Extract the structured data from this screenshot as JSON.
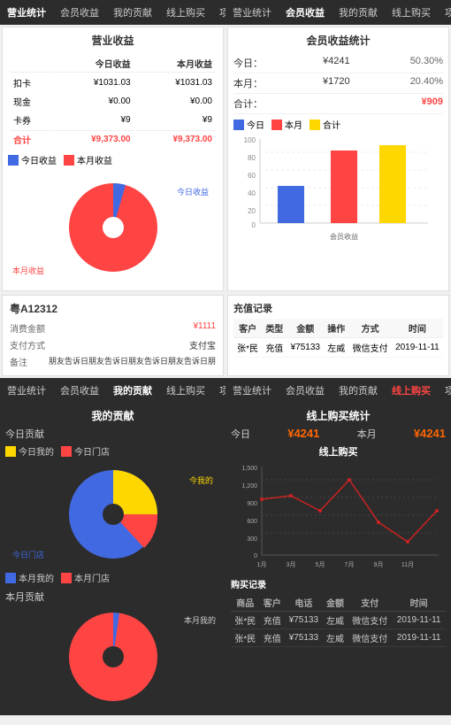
{
  "nav1": {
    "items": [
      "营业统计",
      "会员收益",
      "我的贡献",
      "线上购买",
      "项目"
    ],
    "active": "营业统计"
  },
  "nav2": {
    "items": [
      "营业统计",
      "会员收益",
      "我的贡献",
      "线上购买",
      "项目"
    ],
    "active": "会员收益"
  },
  "nav3": {
    "items": [
      "营业统计",
      "会员收益",
      "我的贡献",
      "线上购买",
      "项目"
    ],
    "active": "我的贡献"
  },
  "nav4": {
    "items": [
      "营业统计",
      "会员收益",
      "我的贡献",
      "线上购买",
      "项目"
    ],
    "active": "线上购买"
  },
  "revenue": {
    "title": "营业收益",
    "today_label": "今日收益",
    "month_label": "本月收益",
    "rows": [
      {
        "name": "扣卡",
        "today": "¥1031.03",
        "month": "¥1031.03"
      },
      {
        "name": "现金",
        "today": "¥0.00",
        "month": "¥0.00"
      },
      {
        "name": "卡券",
        "today": "¥9",
        "month": "¥9"
      }
    ],
    "total_label": "合计",
    "total_today": "¥9,373.00",
    "total_month": "¥9,373.00"
  },
  "member_stats": {
    "title": "会员收益统计",
    "today_label": "今日：",
    "today_value": "¥4241",
    "today_pct": "50.30%",
    "month_label": "本月：",
    "month_value": "¥1720",
    "month_pct": "20.40%",
    "total_label": "合计：",
    "total_value": "¥909"
  },
  "legend_revenue": {
    "today": "今日收益",
    "month": "本月收益",
    "colors": [
      "#4169E1",
      "#ff4444"
    ]
  },
  "legend_member": {
    "items": [
      "今日",
      "本月",
      "合计"
    ],
    "colors": [
      "#4169E1",
      "#ff4444",
      "#FFD700"
    ]
  },
  "member_bar": {
    "y_max": 100,
    "y_labels": [
      "100",
      "80",
      "60",
      "40",
      "20",
      "0"
    ],
    "bars": [
      {
        "label": "今日",
        "value": 42,
        "color": "#4169E1"
      },
      {
        "label": "本月",
        "value": 82,
        "color": "#ff4444"
      },
      {
        "label": "合计",
        "value": 88,
        "color": "#FFD700"
      }
    ],
    "x_label": "会员收益"
  },
  "card_info": {
    "id": "粤A12312",
    "rows": [
      {
        "label": "消费金额",
        "value": "¥1111",
        "red": true
      },
      {
        "label": "支付方式",
        "value": "支付宝"
      },
      {
        "label": "备注",
        "value": "朋友告诉日朋友告诉日朋友告诉日朋友告诉日朋"
      }
    ]
  },
  "recharge": {
    "title": "充值记录",
    "headers": [
      "客户",
      "类型",
      "金额",
      "操作",
      "方式",
      "时间"
    ],
    "rows": [
      {
        "customer": "张*民",
        "type": "充值",
        "amount": "¥75133",
        "op": "左威",
        "method": "微信支付",
        "time": "2019-11-11"
      }
    ]
  },
  "contribution": {
    "title": "我的贡献",
    "today_label": "今日贡献",
    "legend_my": "今日我的",
    "legend_shop": "今日门店",
    "colors_today": [
      "#FFD700",
      "#4169E1",
      "#ff4444"
    ],
    "month_label": "本月贡献",
    "legend_month_my": "本月我的",
    "legend_month_shop": "本月门店",
    "pie_today_label": "今我的",
    "pie_month_label": "本月我的"
  },
  "online": {
    "title": "线上购买统计",
    "today_label": "今日",
    "today_value": "¥4241",
    "month_label": "本月",
    "month_value": "¥4241",
    "chart_title": "线上购买",
    "x_labels": [
      "1月",
      "3月",
      "5月",
      "7月",
      "9月",
      "11月"
    ],
    "y_max": 1500,
    "y_labels": [
      "1,500",
      "1,200",
      "900",
      "600",
      "300",
      "0"
    ],
    "purchase_title": "购买记录",
    "purchase_headers": [
      "商品",
      "客户",
      "电话",
      "金额",
      "支付",
      "时间"
    ],
    "purchase_rows": [
      {
        "product": "张*民",
        "customer": "充值",
        "phone": "¥75133",
        "amount": "左威",
        "payment": "微信支付",
        "time": "2019-11-11"
      },
      {
        "product": "张*民",
        "customer": "充值",
        "phone": "¥75133",
        "amount": "左威",
        "payment": "微信支付",
        "time": "2019-11-11"
      }
    ]
  }
}
